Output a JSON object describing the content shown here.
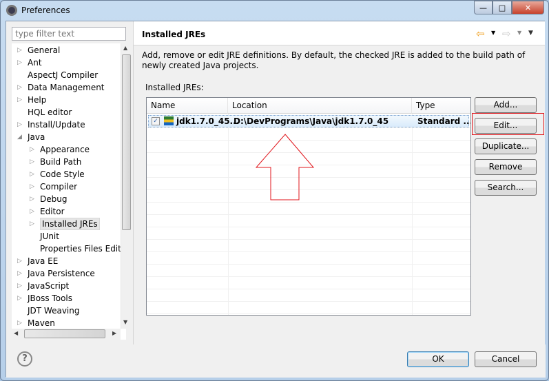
{
  "window": {
    "title": "Preferences",
    "minimize": "—",
    "maximize": "□",
    "close": "✕"
  },
  "filter": {
    "placeholder": "type filter text"
  },
  "tree": [
    {
      "label": "General",
      "expander": "collapsed",
      "level": 0
    },
    {
      "label": "Ant",
      "expander": "collapsed",
      "level": 0
    },
    {
      "label": "AspectJ Compiler",
      "expander": "none",
      "level": 0
    },
    {
      "label": "Data Management",
      "expander": "collapsed",
      "level": 0
    },
    {
      "label": "Help",
      "expander": "collapsed",
      "level": 0
    },
    {
      "label": "HQL editor",
      "expander": "none",
      "level": 0
    },
    {
      "label": "Install/Update",
      "expander": "collapsed",
      "level": 0
    },
    {
      "label": "Java",
      "expander": "expanded",
      "level": 0
    },
    {
      "label": "Appearance",
      "expander": "collapsed",
      "level": 1
    },
    {
      "label": "Build Path",
      "expander": "collapsed",
      "level": 1
    },
    {
      "label": "Code Style",
      "expander": "collapsed",
      "level": 1
    },
    {
      "label": "Compiler",
      "expander": "collapsed",
      "level": 1
    },
    {
      "label": "Debug",
      "expander": "collapsed",
      "level": 1
    },
    {
      "label": "Editor",
      "expander": "collapsed",
      "level": 1
    },
    {
      "label": "Installed JREs",
      "expander": "collapsed",
      "level": 1,
      "selected": true
    },
    {
      "label": "JUnit",
      "expander": "none",
      "level": 1
    },
    {
      "label": "Properties Files Editor",
      "expander": "none",
      "level": 1
    },
    {
      "label": "Java EE",
      "expander": "collapsed",
      "level": 0
    },
    {
      "label": "Java Persistence",
      "expander": "collapsed",
      "level": 0
    },
    {
      "label": "JavaScript",
      "expander": "collapsed",
      "level": 0
    },
    {
      "label": "JBoss Tools",
      "expander": "collapsed",
      "level": 0
    },
    {
      "label": "JDT Weaving",
      "expander": "none",
      "level": 0
    },
    {
      "label": "Maven",
      "expander": "collapsed",
      "level": 0
    }
  ],
  "page": {
    "title": "Installed JREs",
    "description": "Add, remove or edit JRE definitions. By default, the checked JRE is added to the build path of newly created Java projects.",
    "list_label": "Installed JREs:",
    "columns": [
      "Name",
      "Location",
      "Type"
    ],
    "rows": [
      {
        "checked": true,
        "name": "jdk1.7.0_45...",
        "location": "D:\\DevPrograms\\Java\\jdk1.7.0_45",
        "type": "Standard ..."
      }
    ],
    "buttons": [
      "Add...",
      "Edit...",
      "Duplicate...",
      "Remove",
      "Search..."
    ],
    "highlighted_button": "Edit..."
  },
  "nav": {
    "back_icon": "back-arrow-icon",
    "forward_icon": "forward-arrow-icon",
    "menu_icon": "view-menu-icon"
  },
  "footer": {
    "help": "?",
    "ok": "OK",
    "cancel": "Cancel"
  },
  "colors": {
    "annotation": "#e0151b",
    "selection": "#d9ebfb",
    "back_arrow": "#f0a020"
  }
}
